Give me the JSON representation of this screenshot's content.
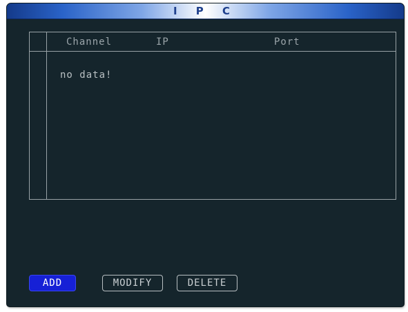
{
  "window": {
    "title": "I P C"
  },
  "table": {
    "columns": [
      "Channel",
      "IP",
      "Port"
    ],
    "empty_message": "no data!"
  },
  "buttons": {
    "add_label": "ADD",
    "modify_label": "MODIFY",
    "delete_label": "DELETE",
    "selected": "ADD"
  },
  "colors": {
    "panel_background": "#15252c",
    "title_bar_accent": "#2a63c8",
    "selected_button": "#1620d6",
    "grid_lines": "#9aa3a7",
    "text": "#b9c0c3"
  }
}
